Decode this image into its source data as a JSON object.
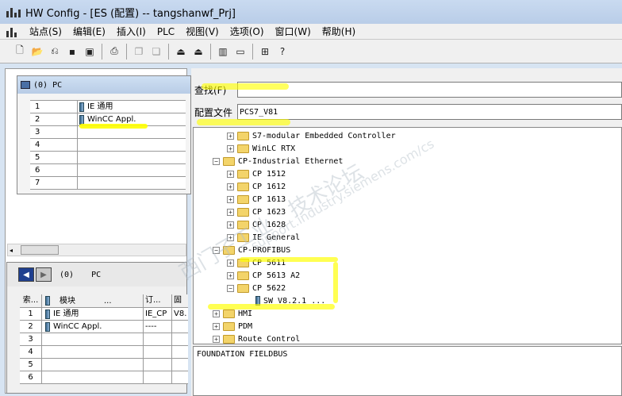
{
  "window": {
    "title": "HW Config - [ES (配置) -- tangshanwf_Prj]"
  },
  "menu": [
    "站点(S)",
    "编辑(E)",
    "插入(I)",
    "PLC",
    "视图(V)",
    "选项(O)",
    "窗口(W)",
    "帮助(H)"
  ],
  "rack": {
    "title": "(0) PC",
    "rows": [
      {
        "slot": "1",
        "module": "IE 通用"
      },
      {
        "slot": "2",
        "module": "WinCC Appl."
      },
      {
        "slot": "3",
        "module": ""
      },
      {
        "slot": "4",
        "module": ""
      },
      {
        "slot": "5",
        "module": ""
      },
      {
        "slot": "6",
        "module": ""
      },
      {
        "slot": "7",
        "module": ""
      }
    ]
  },
  "detail": {
    "nav_label": "(0)",
    "station_label": "PC",
    "headers": {
      "index": "索...",
      "module": "模块",
      "dots": "...",
      "order": "订...",
      "fw": "固"
    },
    "rows": [
      {
        "index": "1",
        "module": "IE 通用",
        "order": "IE_CP",
        "fw": "V8."
      },
      {
        "index": "2",
        "module": "WinCC Appl.",
        "order": "----",
        "fw": ""
      },
      {
        "index": "3",
        "module": "",
        "order": "",
        "fw": ""
      },
      {
        "index": "4",
        "module": "",
        "order": "",
        "fw": ""
      },
      {
        "index": "5",
        "module": "",
        "order": "",
        "fw": ""
      },
      {
        "index": "6",
        "module": "",
        "order": "",
        "fw": ""
      }
    ]
  },
  "catalog": {
    "search_label": "查找(F)",
    "search_value": "",
    "profile_label": "配置文件",
    "profile_value": "PCS7_V81",
    "tree": {
      "n1": "S7-modular Embedded Controller",
      "n2": "WinLC RTX",
      "n3": "CP-Industrial Ethernet",
      "n4": "CP 1512",
      "n5": "CP 1612",
      "n6": "CP 1613",
      "n7": "CP 1623",
      "n8": "CP 1628",
      "n9": "IE General",
      "n10": "CP-PROFIBUS",
      "n11": "CP 5611",
      "n12": "CP 5613 A2",
      "n13": "CP 5622",
      "n14": "SW V8.2.1 ...",
      "n15": "HMI",
      "n16": "PDM",
      "n17": "Route Control"
    },
    "info": "FOUNDATION FIELDBUS"
  },
  "watermark": {
    "l1": "西门子工业",
    "l2": "技术论坛",
    "l3": "support.industry.siemens.com/cs"
  },
  "colors": {
    "highlight": "#ffff00",
    "title_bar": "#c9daf0",
    "folder": "#f3d46a"
  }
}
